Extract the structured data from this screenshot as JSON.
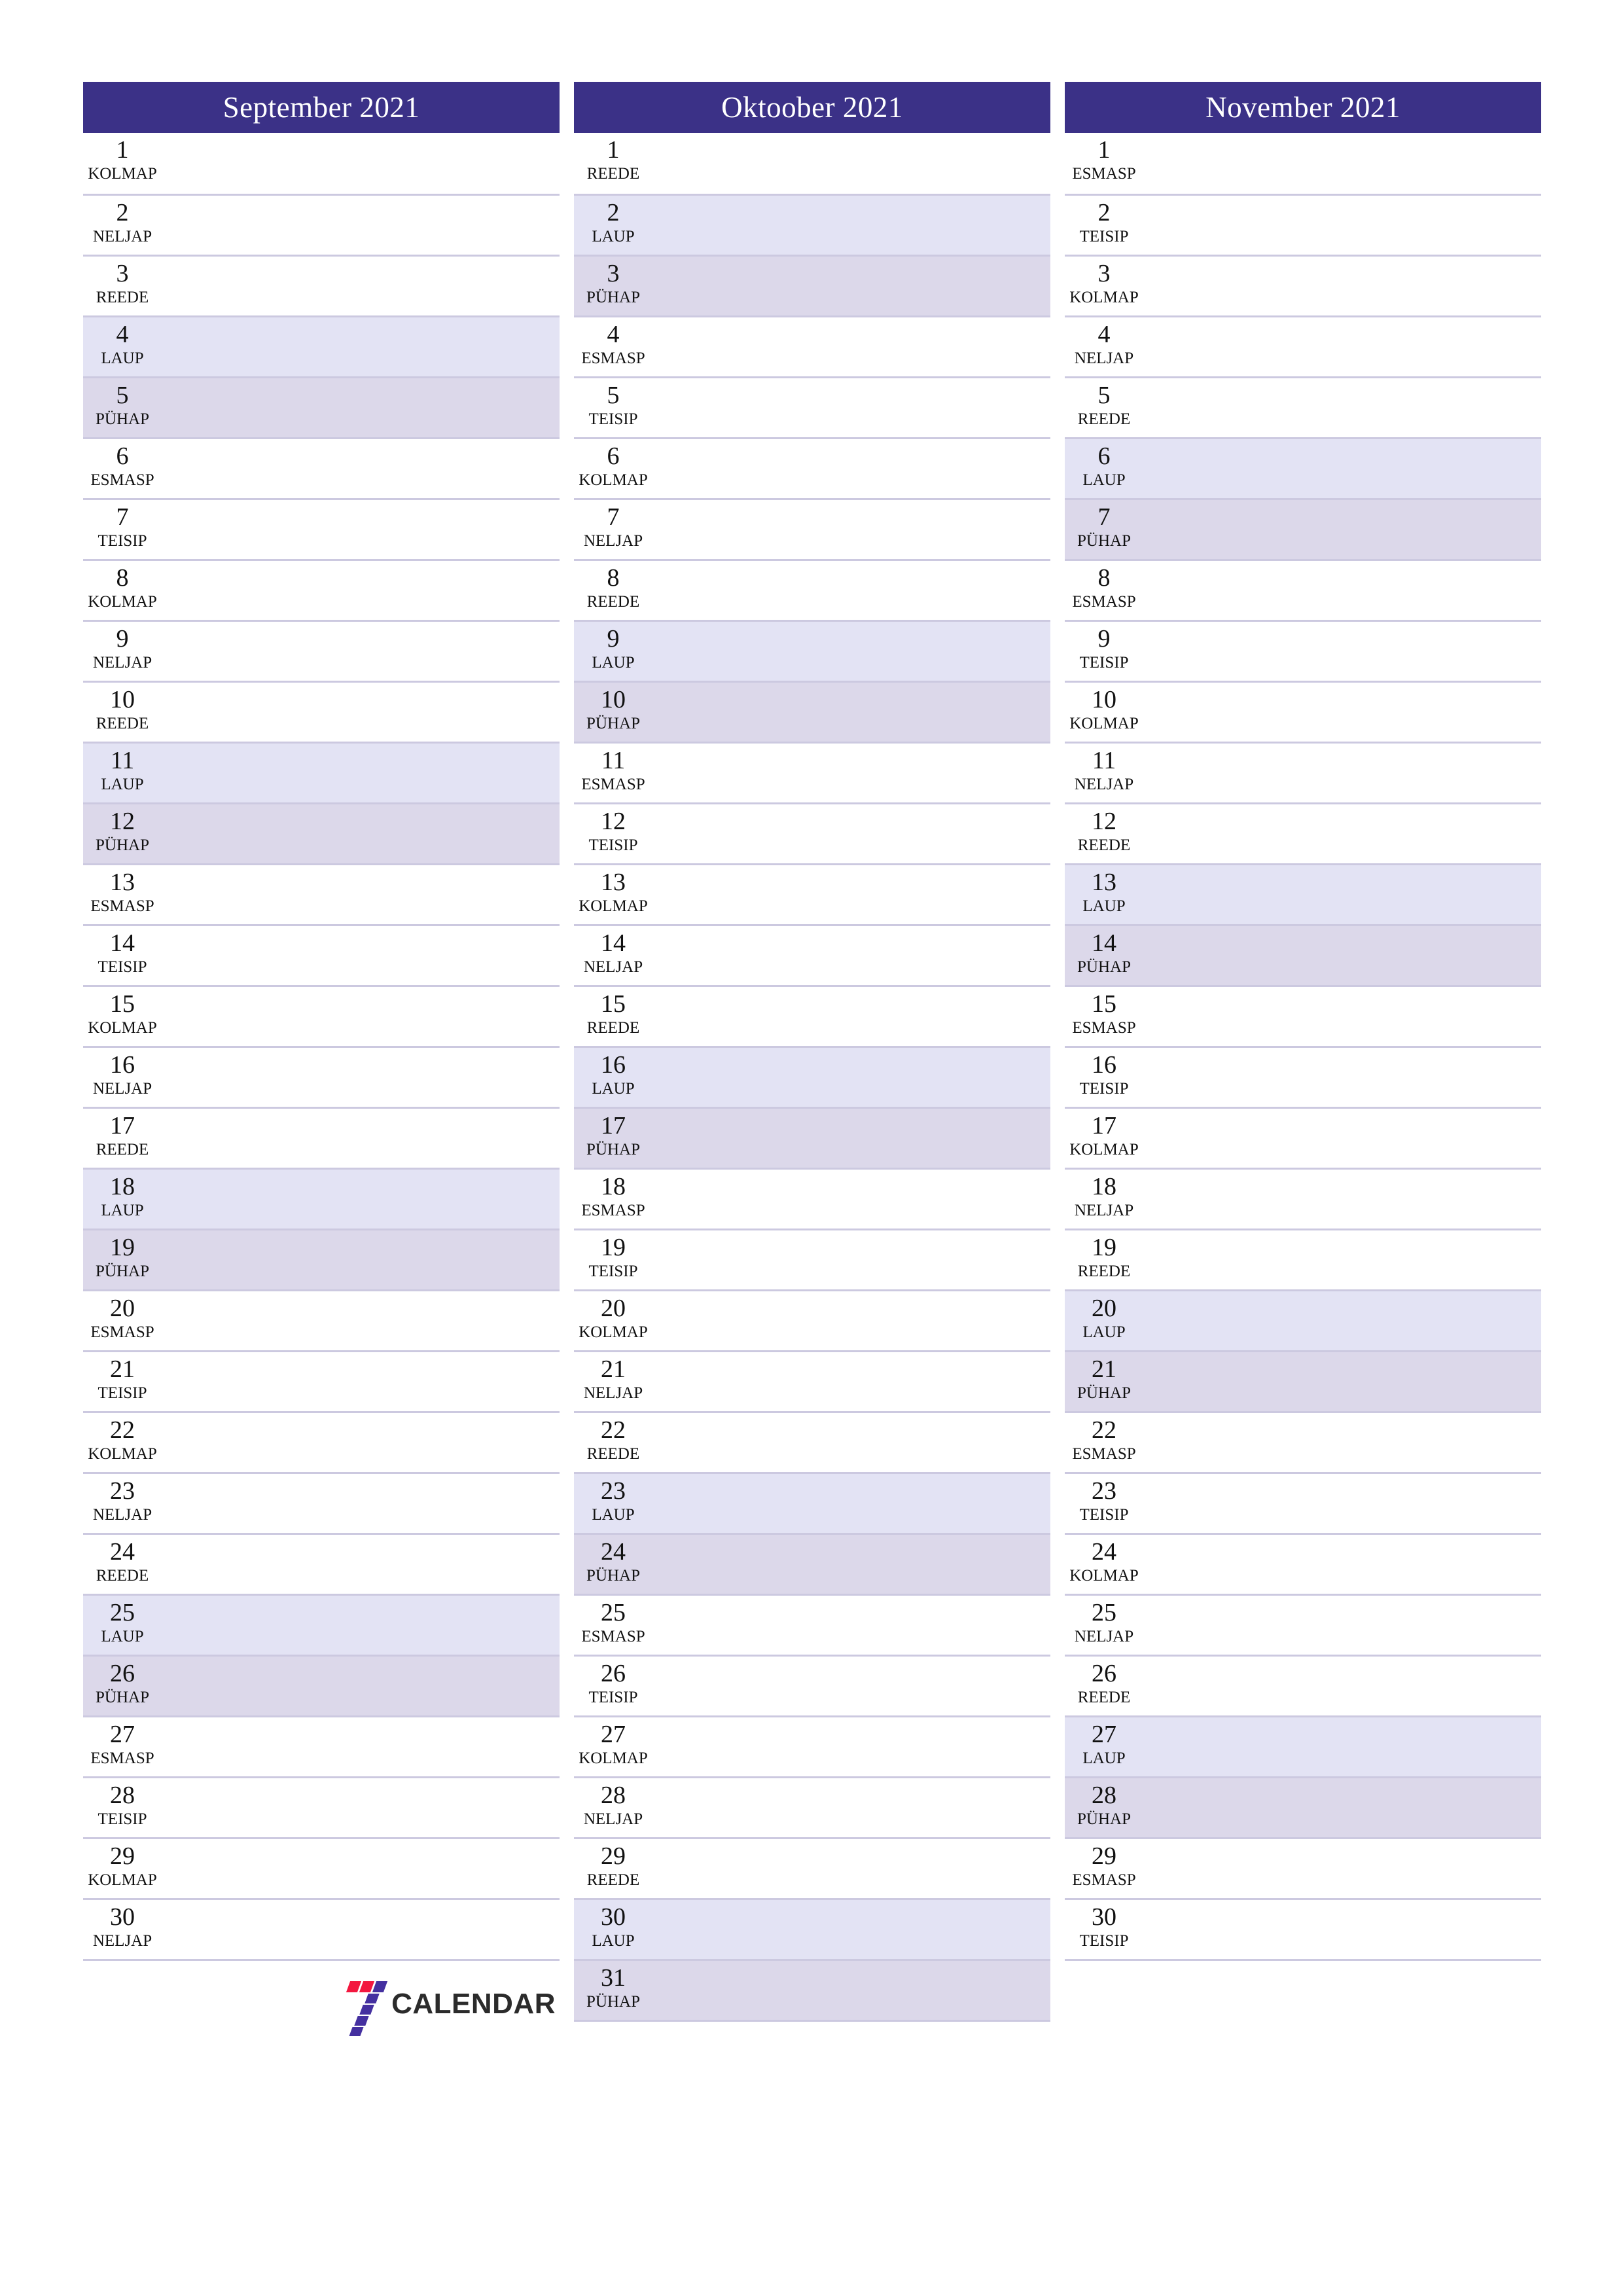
{
  "colors": {
    "header_bg": "#3b3187",
    "header_text": "#ffffff",
    "saturday_bg": "#e3e3f4",
    "sunday_bg": "#dcd8ea",
    "separator": "#ccc9e0",
    "logo_red": "#f3173f",
    "logo_purple": "#4430a0",
    "logo_text": "#2b2b2b"
  },
  "brand": {
    "name": "CALENDAR",
    "mark": "seven-logo-icon"
  },
  "months": [
    {
      "title": "September 2021",
      "days": [
        {
          "num": "1",
          "weekday": "KOLMAP",
          "type": "weekday"
        },
        {
          "num": "2",
          "weekday": "NELJAP",
          "type": "weekday"
        },
        {
          "num": "3",
          "weekday": "REEDE",
          "type": "weekday"
        },
        {
          "num": "4",
          "weekday": "LAUP",
          "type": "sat"
        },
        {
          "num": "5",
          "weekday": "PÜHAP",
          "type": "sun"
        },
        {
          "num": "6",
          "weekday": "ESMASP",
          "type": "weekday"
        },
        {
          "num": "7",
          "weekday": "TEISIP",
          "type": "weekday"
        },
        {
          "num": "8",
          "weekday": "KOLMAP",
          "type": "weekday"
        },
        {
          "num": "9",
          "weekday": "NELJAP",
          "type": "weekday"
        },
        {
          "num": "10",
          "weekday": "REEDE",
          "type": "weekday"
        },
        {
          "num": "11",
          "weekday": "LAUP",
          "type": "sat"
        },
        {
          "num": "12",
          "weekday": "PÜHAP",
          "type": "sun"
        },
        {
          "num": "13",
          "weekday": "ESMASP",
          "type": "weekday"
        },
        {
          "num": "14",
          "weekday": "TEISIP",
          "type": "weekday"
        },
        {
          "num": "15",
          "weekday": "KOLMAP",
          "type": "weekday"
        },
        {
          "num": "16",
          "weekday": "NELJAP",
          "type": "weekday"
        },
        {
          "num": "17",
          "weekday": "REEDE",
          "type": "weekday"
        },
        {
          "num": "18",
          "weekday": "LAUP",
          "type": "sat"
        },
        {
          "num": "19",
          "weekday": "PÜHAP",
          "type": "sun"
        },
        {
          "num": "20",
          "weekday": "ESMASP",
          "type": "weekday"
        },
        {
          "num": "21",
          "weekday": "TEISIP",
          "type": "weekday"
        },
        {
          "num": "22",
          "weekday": "KOLMAP",
          "type": "weekday"
        },
        {
          "num": "23",
          "weekday": "NELJAP",
          "type": "weekday"
        },
        {
          "num": "24",
          "weekday": "REEDE",
          "type": "weekday"
        },
        {
          "num": "25",
          "weekday": "LAUP",
          "type": "sat"
        },
        {
          "num": "26",
          "weekday": "PÜHAP",
          "type": "sun"
        },
        {
          "num": "27",
          "weekday": "ESMASP",
          "type": "weekday"
        },
        {
          "num": "28",
          "weekday": "TEISIP",
          "type": "weekday"
        },
        {
          "num": "29",
          "weekday": "KOLMAP",
          "type": "weekday"
        },
        {
          "num": "30",
          "weekday": "NELJAP",
          "type": "weekday"
        }
      ]
    },
    {
      "title": "Oktoober 2021",
      "days": [
        {
          "num": "1",
          "weekday": "REEDE",
          "type": "weekday"
        },
        {
          "num": "2",
          "weekday": "LAUP",
          "type": "sat"
        },
        {
          "num": "3",
          "weekday": "PÜHAP",
          "type": "sun"
        },
        {
          "num": "4",
          "weekday": "ESMASP",
          "type": "weekday"
        },
        {
          "num": "5",
          "weekday": "TEISIP",
          "type": "weekday"
        },
        {
          "num": "6",
          "weekday": "KOLMAP",
          "type": "weekday"
        },
        {
          "num": "7",
          "weekday": "NELJAP",
          "type": "weekday"
        },
        {
          "num": "8",
          "weekday": "REEDE",
          "type": "weekday"
        },
        {
          "num": "9",
          "weekday": "LAUP",
          "type": "sat"
        },
        {
          "num": "10",
          "weekday": "PÜHAP",
          "type": "sun"
        },
        {
          "num": "11",
          "weekday": "ESMASP",
          "type": "weekday"
        },
        {
          "num": "12",
          "weekday": "TEISIP",
          "type": "weekday"
        },
        {
          "num": "13",
          "weekday": "KOLMAP",
          "type": "weekday"
        },
        {
          "num": "14",
          "weekday": "NELJAP",
          "type": "weekday"
        },
        {
          "num": "15",
          "weekday": "REEDE",
          "type": "weekday"
        },
        {
          "num": "16",
          "weekday": "LAUP",
          "type": "sat"
        },
        {
          "num": "17",
          "weekday": "PÜHAP",
          "type": "sun"
        },
        {
          "num": "18",
          "weekday": "ESMASP",
          "type": "weekday"
        },
        {
          "num": "19",
          "weekday": "TEISIP",
          "type": "weekday"
        },
        {
          "num": "20",
          "weekday": "KOLMAP",
          "type": "weekday"
        },
        {
          "num": "21",
          "weekday": "NELJAP",
          "type": "weekday"
        },
        {
          "num": "22",
          "weekday": "REEDE",
          "type": "weekday"
        },
        {
          "num": "23",
          "weekday": "LAUP",
          "type": "sat"
        },
        {
          "num": "24",
          "weekday": "PÜHAP",
          "type": "sun"
        },
        {
          "num": "25",
          "weekday": "ESMASP",
          "type": "weekday"
        },
        {
          "num": "26",
          "weekday": "TEISIP",
          "type": "weekday"
        },
        {
          "num": "27",
          "weekday": "KOLMAP",
          "type": "weekday"
        },
        {
          "num": "28",
          "weekday": "NELJAP",
          "type": "weekday"
        },
        {
          "num": "29",
          "weekday": "REEDE",
          "type": "weekday"
        },
        {
          "num": "30",
          "weekday": "LAUP",
          "type": "sat"
        },
        {
          "num": "31",
          "weekday": "PÜHAP",
          "type": "sun"
        }
      ]
    },
    {
      "title": "November 2021",
      "days": [
        {
          "num": "1",
          "weekday": "ESMASP",
          "type": "weekday"
        },
        {
          "num": "2",
          "weekday": "TEISIP",
          "type": "weekday"
        },
        {
          "num": "3",
          "weekday": "KOLMAP",
          "type": "weekday"
        },
        {
          "num": "4",
          "weekday": "NELJAP",
          "type": "weekday"
        },
        {
          "num": "5",
          "weekday": "REEDE",
          "type": "weekday"
        },
        {
          "num": "6",
          "weekday": "LAUP",
          "type": "sat"
        },
        {
          "num": "7",
          "weekday": "PÜHAP",
          "type": "sun"
        },
        {
          "num": "8",
          "weekday": "ESMASP",
          "type": "weekday"
        },
        {
          "num": "9",
          "weekday": "TEISIP",
          "type": "weekday"
        },
        {
          "num": "10",
          "weekday": "KOLMAP",
          "type": "weekday"
        },
        {
          "num": "11",
          "weekday": "NELJAP",
          "type": "weekday"
        },
        {
          "num": "12",
          "weekday": "REEDE",
          "type": "weekday"
        },
        {
          "num": "13",
          "weekday": "LAUP",
          "type": "sat"
        },
        {
          "num": "14",
          "weekday": "PÜHAP",
          "type": "sun"
        },
        {
          "num": "15",
          "weekday": "ESMASP",
          "type": "weekday"
        },
        {
          "num": "16",
          "weekday": "TEISIP",
          "type": "weekday"
        },
        {
          "num": "17",
          "weekday": "KOLMAP",
          "type": "weekday"
        },
        {
          "num": "18",
          "weekday": "NELJAP",
          "type": "weekday"
        },
        {
          "num": "19",
          "weekday": "REEDE",
          "type": "weekday"
        },
        {
          "num": "20",
          "weekday": "LAUP",
          "type": "sat"
        },
        {
          "num": "21",
          "weekday": "PÜHAP",
          "type": "sun"
        },
        {
          "num": "22",
          "weekday": "ESMASP",
          "type": "weekday"
        },
        {
          "num": "23",
          "weekday": "TEISIP",
          "type": "weekday"
        },
        {
          "num": "24",
          "weekday": "KOLMAP",
          "type": "weekday"
        },
        {
          "num": "25",
          "weekday": "NELJAP",
          "type": "weekday"
        },
        {
          "num": "26",
          "weekday": "REEDE",
          "type": "weekday"
        },
        {
          "num": "27",
          "weekday": "LAUP",
          "type": "sat"
        },
        {
          "num": "28",
          "weekday": "PÜHAP",
          "type": "sun"
        },
        {
          "num": "29",
          "weekday": "ESMASP",
          "type": "weekday"
        },
        {
          "num": "30",
          "weekday": "TEISIP",
          "type": "weekday"
        }
      ]
    }
  ]
}
